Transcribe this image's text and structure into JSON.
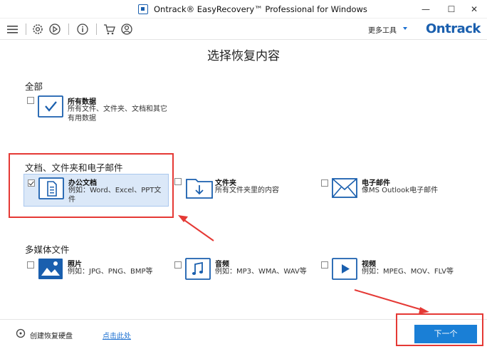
{
  "window": {
    "title": "Ontrack® EasyRecovery™ Professional for Windows",
    "minimize": "—",
    "maximize": "☐",
    "close": "✕"
  },
  "toolbar": {
    "more_tools": "更多工具",
    "brand": "Ontrack",
    "icons": [
      "menu-icon",
      "gear-icon",
      "history-icon",
      "info-icon",
      "cart-icon",
      "account-icon"
    ]
  },
  "page_title": "选择恢复内容",
  "sections": {
    "all": {
      "label": "全部",
      "options": [
        {
          "name": "所有数据",
          "desc": "所有文件、文件夹、文档和其它有用数据",
          "checked": false
        }
      ]
    },
    "documents": {
      "label": "文档、文件夹和电子邮件",
      "options": [
        {
          "name": "办公文档",
          "desc": "例如：Word、Excel、PPT文件",
          "checked": true
        },
        {
          "name": "文件夹",
          "desc": "所有文件夹里的内容",
          "checked": false
        },
        {
          "name": "电子邮件",
          "desc": "像MS Outlook电子邮件",
          "checked": false
        }
      ]
    },
    "multimedia": {
      "label": "多媒体文件",
      "options": [
        {
          "name": "照片",
          "desc": "例如：JPG、PNG、BMP等",
          "checked": false
        },
        {
          "name": "音频",
          "desc": "例如：MP3、WMA、WAV等",
          "checked": false
        },
        {
          "name": "视频",
          "desc": "例如：MPEG、MOV、FLV等",
          "checked": false
        }
      ]
    }
  },
  "footer": {
    "create_disk": "创建恢复硬盘",
    "click_here": "点击此处",
    "next": "下一个"
  },
  "colors": {
    "accent": "#1a7fd6",
    "brand": "#1a5fae",
    "annotation": "#e53935"
  }
}
